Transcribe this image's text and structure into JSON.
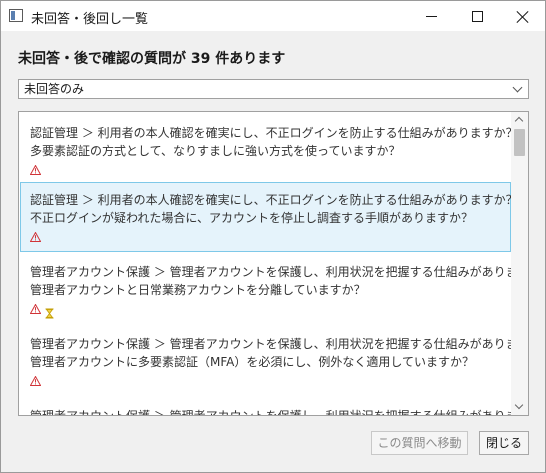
{
  "window": {
    "title": "未回答・後回し一覧"
  },
  "heading": "未回答・後で確認の質問が 39 件あります",
  "filter": {
    "selected": "未回答のみ"
  },
  "list": {
    "items": [
      {
        "path": "認証管理 ＞ 利用者の本人確認を確実にし、不正ログインを防止する仕組みがありますか？",
        "question": "多要素認証の方式として、なりすましに強い方式を使っていますか？",
        "icons": [
          "warning-icon"
        ],
        "selected": false
      },
      {
        "path": "認証管理 ＞ 利用者の本人確認を確実にし、不正ログインを防止する仕組みがありますか？",
        "question": "不正ログインが疑われた場合に、アカウントを停止し調査する手順がありますか？",
        "icons": [
          "warning-icon"
        ],
        "selected": true
      },
      {
        "path": "管理者アカウント保護 ＞ 管理者アカウントを保護し、利用状況を把握する仕組みがありますか？",
        "question": "管理者アカウントと日常業務アカウントを分離していますか？",
        "icons": [
          "warning-icon",
          "hourglass-icon"
        ],
        "selected": false
      },
      {
        "path": "管理者アカウント保護 ＞ 管理者アカウントを保護し、利用状況を把握する仕組みがありますか？",
        "question": "管理者アカウントに多要素認証（MFA）を必須にし、例外なく適用していますか？",
        "icons": [
          "warning-icon"
        ],
        "selected": false
      },
      {
        "path": "管理者アカウント保護 ＞ 管理者アカウントを保護し、利用状況を把握する仕組みがありますか？",
        "question": "",
        "icons": [],
        "selected": false
      }
    ]
  },
  "buttons": {
    "goto_label": "この質問へ移動",
    "close_label": "閉じる"
  },
  "colors": {
    "warning": "#d13438",
    "hourglass": "#c19c00",
    "selection_bg": "#e5f3fb",
    "selection_border": "#7ec8e8"
  }
}
